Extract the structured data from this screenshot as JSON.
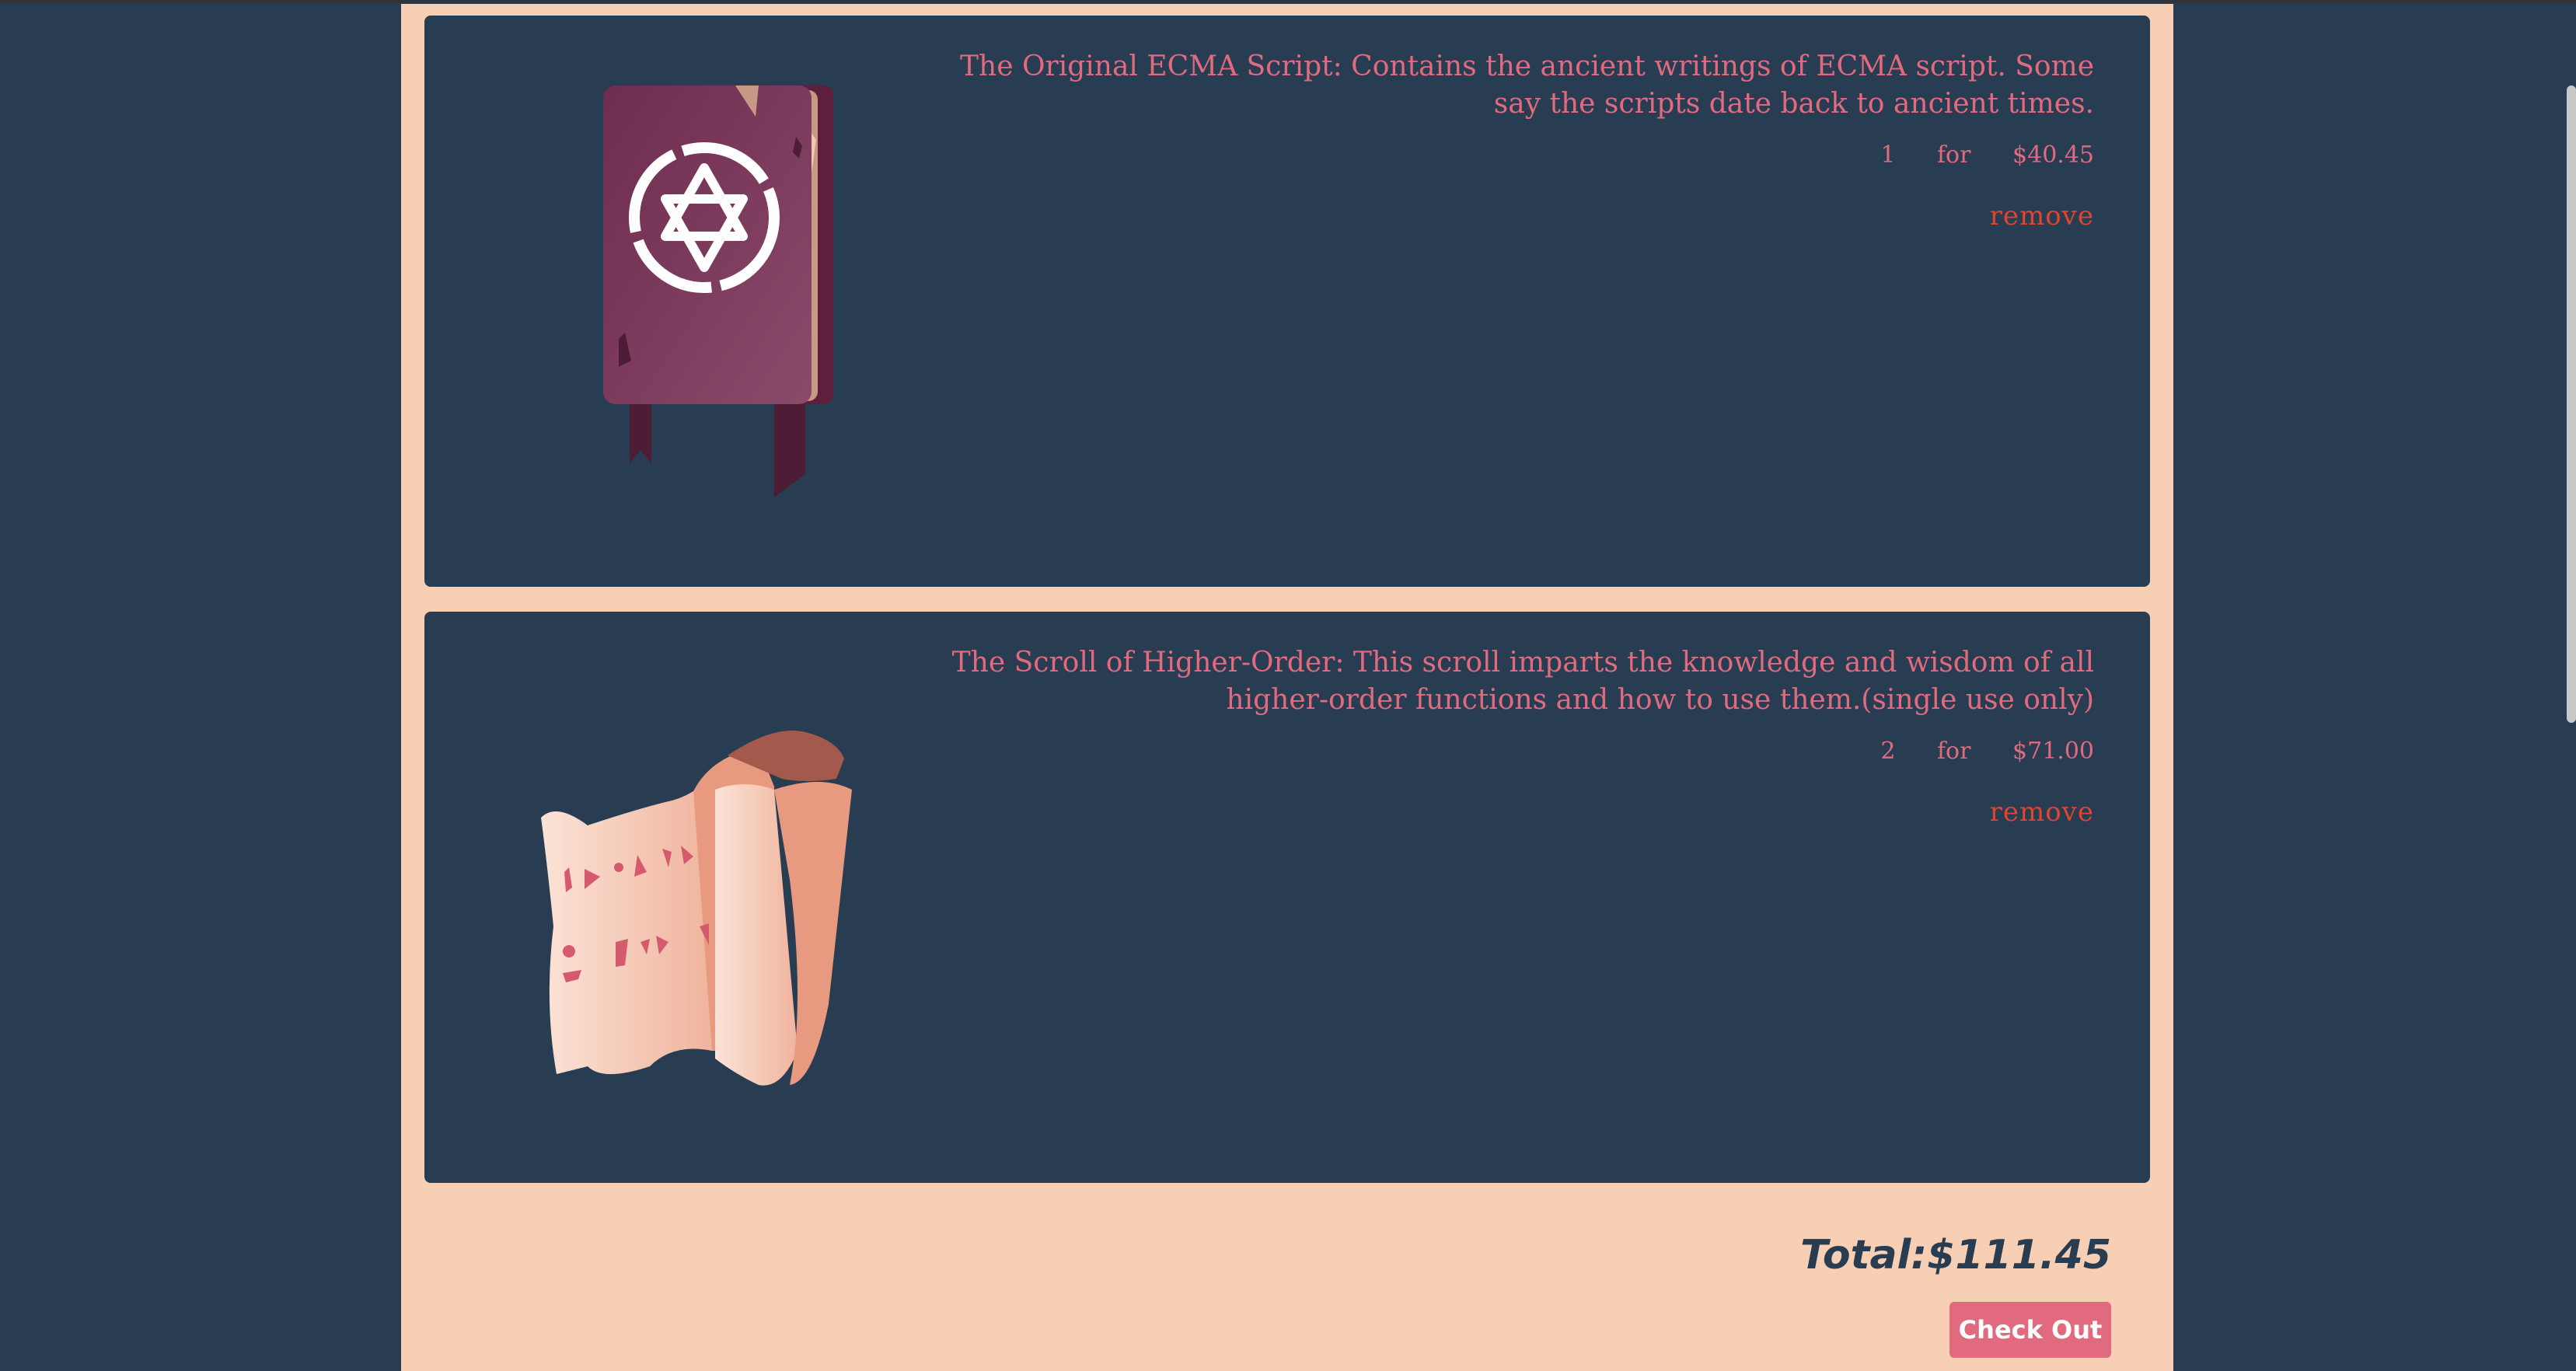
{
  "cart": {
    "items": [
      {
        "description": "The Original ECMA Script: Contains the ancient writings of ECMA script. Some say the scripts date back to ancient times.",
        "quantity": "1",
        "for_label": "for",
        "price": "$40.45",
        "remove_label": "remove",
        "icon": "book-icon"
      },
      {
        "description": "The Scroll of Higher-Order: This scroll imparts the knowledge and wisdom of all higher-order functions and how to use them.(single use only)",
        "quantity": "2",
        "for_label": "for",
        "price": "$71.00",
        "remove_label": "remove",
        "icon": "scroll-icon"
      }
    ],
    "total": "Total:$111.45",
    "checkout_label": "Check Out"
  },
  "colors": {
    "background": "#283d52",
    "panel": "#f7cfb5",
    "accent": "#e16a7e",
    "remove": "#e2452e"
  }
}
